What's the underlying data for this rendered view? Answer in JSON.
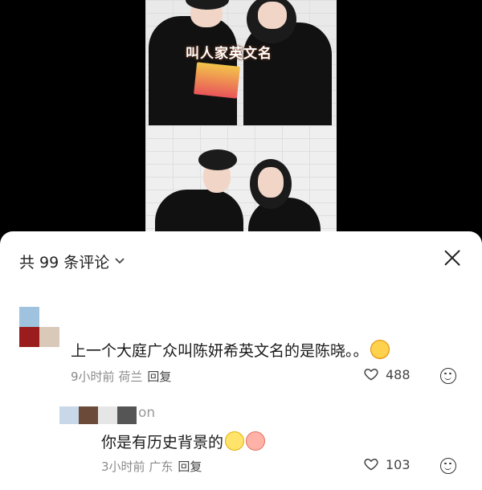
{
  "video": {
    "caption": "叫人家英文名"
  },
  "comments_panel": {
    "title": "共 99 条评论",
    "title_chevron_icon": "chevron-down-icon",
    "close_icon": "close-icon"
  },
  "comments": [
    {
      "text": "上一个大庭广众叫陈妍希英文名的是陈晓。。",
      "emoji": "laughing-emoji",
      "time": "9小时前",
      "location": "荷兰",
      "reply_label": "回复",
      "likes": "488"
    },
    {
      "nickname_suffix": "on",
      "text": "你是有历史背景的",
      "emojis": [
        "chick-emoji",
        "peach-emoji"
      ],
      "time": "3小时前",
      "location": "广东",
      "reply_label": "回复",
      "likes": "103"
    }
  ],
  "colors": {
    "sheet_bg": "#ffffff",
    "text_primary": "#1a1a1a",
    "text_secondary": "#8a8a8a"
  }
}
